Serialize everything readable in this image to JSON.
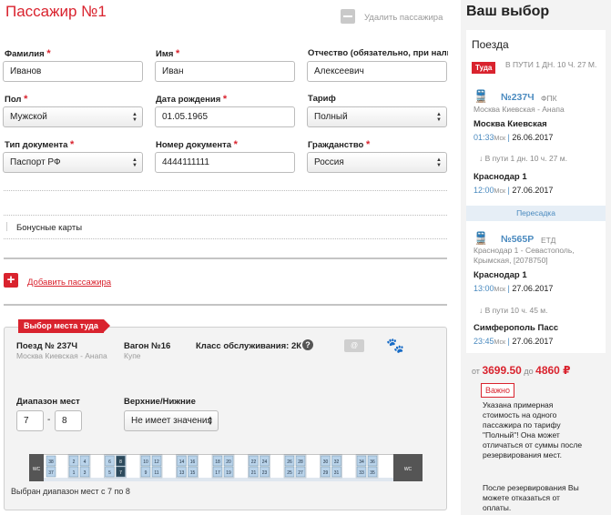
{
  "passenger": {
    "title": "Пассажир №1",
    "delete_label": "Удалить пассажира",
    "fields": {
      "last_name": {
        "label": "Фамилия",
        "value": "Иванов"
      },
      "first_name": {
        "label": "Имя",
        "value": "Иван"
      },
      "middle_name": {
        "label": "Отчество (обязательно, при наличии)",
        "value": "Алексеевич"
      },
      "gender": {
        "label": "Пол",
        "value": "Мужской"
      },
      "birth_date": {
        "label": "Дата рождения",
        "value": "01.05.1965"
      },
      "tariff": {
        "label": "Тариф",
        "value": "Полный"
      },
      "doc_type": {
        "label": "Тип документа",
        "value": "Паспорт РФ"
      },
      "doc_number": {
        "label": "Номер документа",
        "value": "4444111111"
      },
      "citizenship": {
        "label": "Гражданство",
        "value": "Россия"
      }
    },
    "bonus_cards_label": "Бонусные карты",
    "add_passenger_label": "Добавить пассажира"
  },
  "seat_selection": {
    "tag": "Выбор места туда",
    "train_label": "Поезд № 237Ч",
    "train_route": "Москва Киевская - Анапа",
    "car_label": "Вагон №16",
    "car_type": "Купе",
    "service_class": "Класс обслуживания: 2К",
    "info_icon_glyph": "?",
    "service_icon_glyph": "@",
    "paw_icon_glyph": "🐾",
    "range_label": "Диапазон мест",
    "range_from": "7",
    "range_dash": "-",
    "range_to": "8",
    "berth_label": "Верхние/Нижние",
    "berth_value": "Не имеет значения",
    "wc_label": "WC",
    "compartments": [
      {
        "top": [
          "2",
          "4"
        ],
        "bottom": [
          "1",
          "3"
        ]
      },
      {
        "top": [
          "6",
          "8"
        ],
        "bottom": [
          "5",
          "7"
        ]
      },
      {
        "top": [
          "10",
          "12"
        ],
        "bottom": [
          "9",
          "11"
        ]
      },
      {
        "top": [
          "14",
          "16"
        ],
        "bottom": [
          "13",
          "15"
        ]
      },
      {
        "top": [
          "18",
          "20"
        ],
        "bottom": [
          "17",
          "19"
        ]
      },
      {
        "top": [
          "22",
          "24"
        ],
        "bottom": [
          "21",
          "23"
        ]
      },
      {
        "top": [
          "26",
          "28"
        ],
        "bottom": [
          "25",
          "27"
        ]
      },
      {
        "top": [
          "30",
          "32"
        ],
        "bottom": [
          "29",
          "31"
        ]
      },
      {
        "top": [
          "34",
          "36"
        ],
        "bottom": [
          "33",
          "35"
        ]
      }
    ],
    "side_seats": {
      "top": "38",
      "bottom": "37"
    },
    "selected_seats": [
      "7",
      "8"
    ],
    "selected_text": "Выбран диапазон мест с 7 по 8"
  },
  "summary": {
    "title": "Ваш выбор",
    "trains_label": "Поезда",
    "direction_badge": "Туда",
    "travel_time": "В ПУТИ 1 ДН. 10 Ч. 27 М.",
    "train_icon_glyph": "🚆",
    "segments": [
      {
        "number": "№237Ч",
        "carrier": "ФПК",
        "route": "Москва Киевская - Анапа",
        "from": "Москва Киевская",
        "dep_time": "01:33",
        "tz": "Мск",
        "dep_date": "26.06.2017",
        "duration": "В пути 1 дн. 10 ч. 27 м.",
        "to": "Краснодар 1",
        "arr_time": "12:00",
        "arr_date": "27.06.2017"
      },
      {
        "number": "№565Р",
        "carrier": "ЕТД",
        "route": "Краснодар 1 - Севастополь, Крымская, [2078750]",
        "from": "Краснодар 1",
        "dep_time": "13:00",
        "tz": "Мск",
        "dep_date": "27.06.2017",
        "duration": "В пути 10 ч. 45 м.",
        "to": "Симферополь Пасс",
        "arr_time": "23:45",
        "arr_date": "27.06.2017"
      }
    ],
    "transfer_label": "Пересадка",
    "price_from_label": "от",
    "price_from": "3699.50",
    "price_to_label": "до",
    "price_to": "4860 ₽",
    "important_label": "Важно",
    "note1": "Указана примерная стоимость на одного пассажира по тарифу \"Полный\"! Она может отличаться от суммы после резервирования мест.",
    "note2": "После резервирования Вы можете отказаться от оплаты."
  },
  "colors": {
    "accent": "#d9232e",
    "link": "#4a8abf",
    "panel": "#f3f3f3"
  }
}
